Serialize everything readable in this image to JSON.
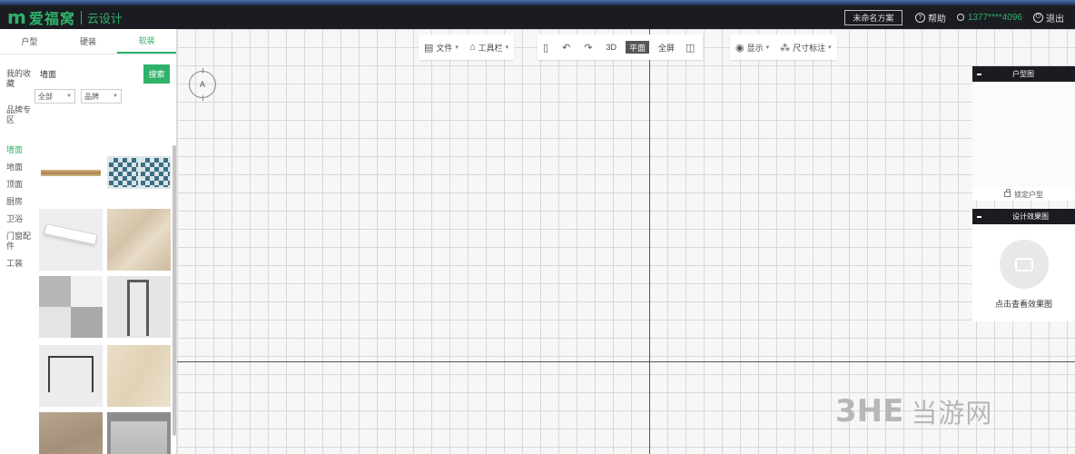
{
  "header": {
    "logo_mark": "m",
    "brand": "爱福窝",
    "sub_brand": "云设计",
    "plan_name": "未命名方案",
    "help_label": "帮助",
    "phone": "1377****4096",
    "exit_label": "退出"
  },
  "left_panel": {
    "tabs": [
      {
        "label": "户型"
      },
      {
        "label": "硬装"
      },
      {
        "label": "软装"
      }
    ],
    "categories": [
      {
        "label": "我的收藏"
      },
      {
        "label": "品牌专区"
      },
      {
        "label": "墙面"
      },
      {
        "label": "地面"
      },
      {
        "label": "顶面"
      },
      {
        "label": "厨房"
      },
      {
        "label": "卫浴"
      },
      {
        "label": "门窗配件"
      },
      {
        "label": "工装"
      }
    ],
    "search": {
      "value": "墙面",
      "button": "搜索"
    },
    "filters": [
      {
        "value": "全部"
      },
      {
        "value": "品牌"
      }
    ],
    "thumbnails": [
      {
        "name": "wood-trim-thumb"
      },
      {
        "name": "patterned-tile-thumb"
      },
      {
        "name": "led-strip-thumb"
      },
      {
        "name": "beige-marble-thumb"
      },
      {
        "name": "gray-tile-thumb"
      },
      {
        "name": "door-frame-thumb"
      },
      {
        "name": "arch-frame-thumb"
      },
      {
        "name": "cream-stone-thumb"
      },
      {
        "name": "brown-texture-thumb"
      },
      {
        "name": "gray-concrete-thumb"
      }
    ]
  },
  "toolbar": {
    "file": "文件",
    "tools": "工具栏",
    "view3d": "3D",
    "plan2d": "平面",
    "fullscreen": "全屏",
    "display": "显示",
    "dimension": "尺寸标注"
  },
  "canvas": {
    "compass_letter": "A"
  },
  "right_panel": {
    "floor_title": "户型图",
    "lock_label": "锁定户型",
    "photo_title": "设计效果图",
    "photo_label": "点击查看效果图"
  },
  "watermark": {
    "latin": "3HE",
    "cn": "当游网"
  },
  "colors": {
    "accent": "#2fb26a",
    "topbar": "#1b1c21"
  }
}
